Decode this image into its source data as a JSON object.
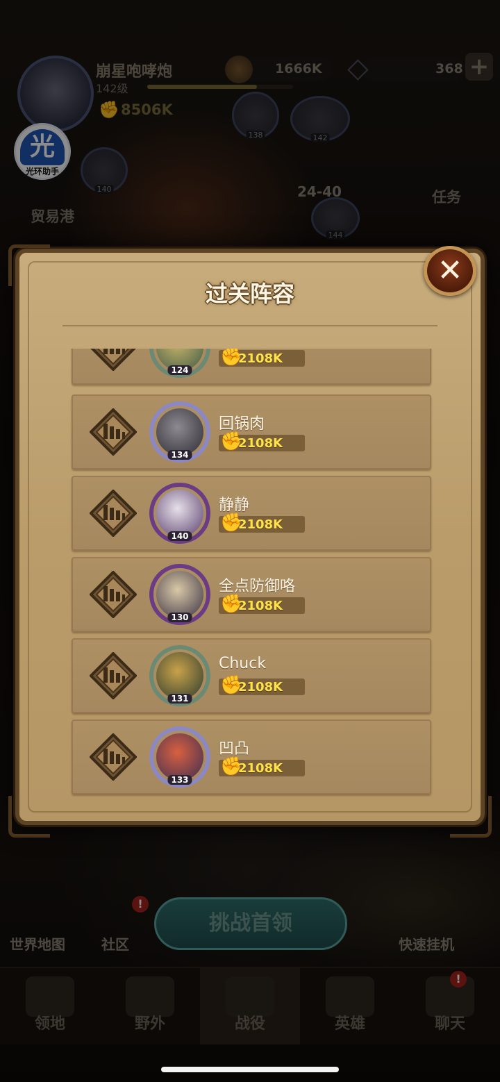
{
  "header": {
    "player_name": "崩星咆哮炮",
    "player_level": "142级",
    "xp_fraction": 0.75,
    "gold": "1666K",
    "gems": "368",
    "plus": "+",
    "power": "8506K"
  },
  "helper_badge": {
    "glyph": "光",
    "label": "光环助手"
  },
  "map": {
    "stage": "24-40",
    "trade_port": "贸易港",
    "quests": "任务",
    "node_levels": [
      "138",
      "142",
      "140",
      "144"
    ]
  },
  "modal": {
    "title": "过关阵容",
    "close": "✕",
    "rows": [
      {
        "name": "",
        "level": "124",
        "power": "2108K",
        "ring": "#6b8a73"
      },
      {
        "name": "回锅肉",
        "level": "134",
        "power": "2108K",
        "ring": "#8c88c4"
      },
      {
        "name": "静静",
        "level": "140",
        "power": "2108K",
        "ring": "#6b3b86"
      },
      {
        "name": "全点防御咯",
        "level": "130",
        "power": "2108K",
        "ring": "#6b3b86"
      },
      {
        "name": "Chuck",
        "level": "131",
        "power": "2108K",
        "ring": "#6b8a73"
      },
      {
        "name": "凹凸",
        "level": "133",
        "power": "2108K",
        "ring": "#8c88c4"
      }
    ]
  },
  "bottom": {
    "world_map": "世界地图",
    "community": "社区",
    "challenge": "挑战首领",
    "quick_idle": "快速挂机",
    "alert": "!"
  },
  "nav": [
    {
      "label": "领地"
    },
    {
      "label": "野外"
    },
    {
      "label": "战役"
    },
    {
      "label": "英雄"
    },
    {
      "label": "聊天"
    }
  ],
  "colors": {
    "parchment": "#c8ac7c",
    "row_bg": "#ae9064",
    "power_text": "#ffe24a",
    "close_button": "#8a3a1a"
  }
}
